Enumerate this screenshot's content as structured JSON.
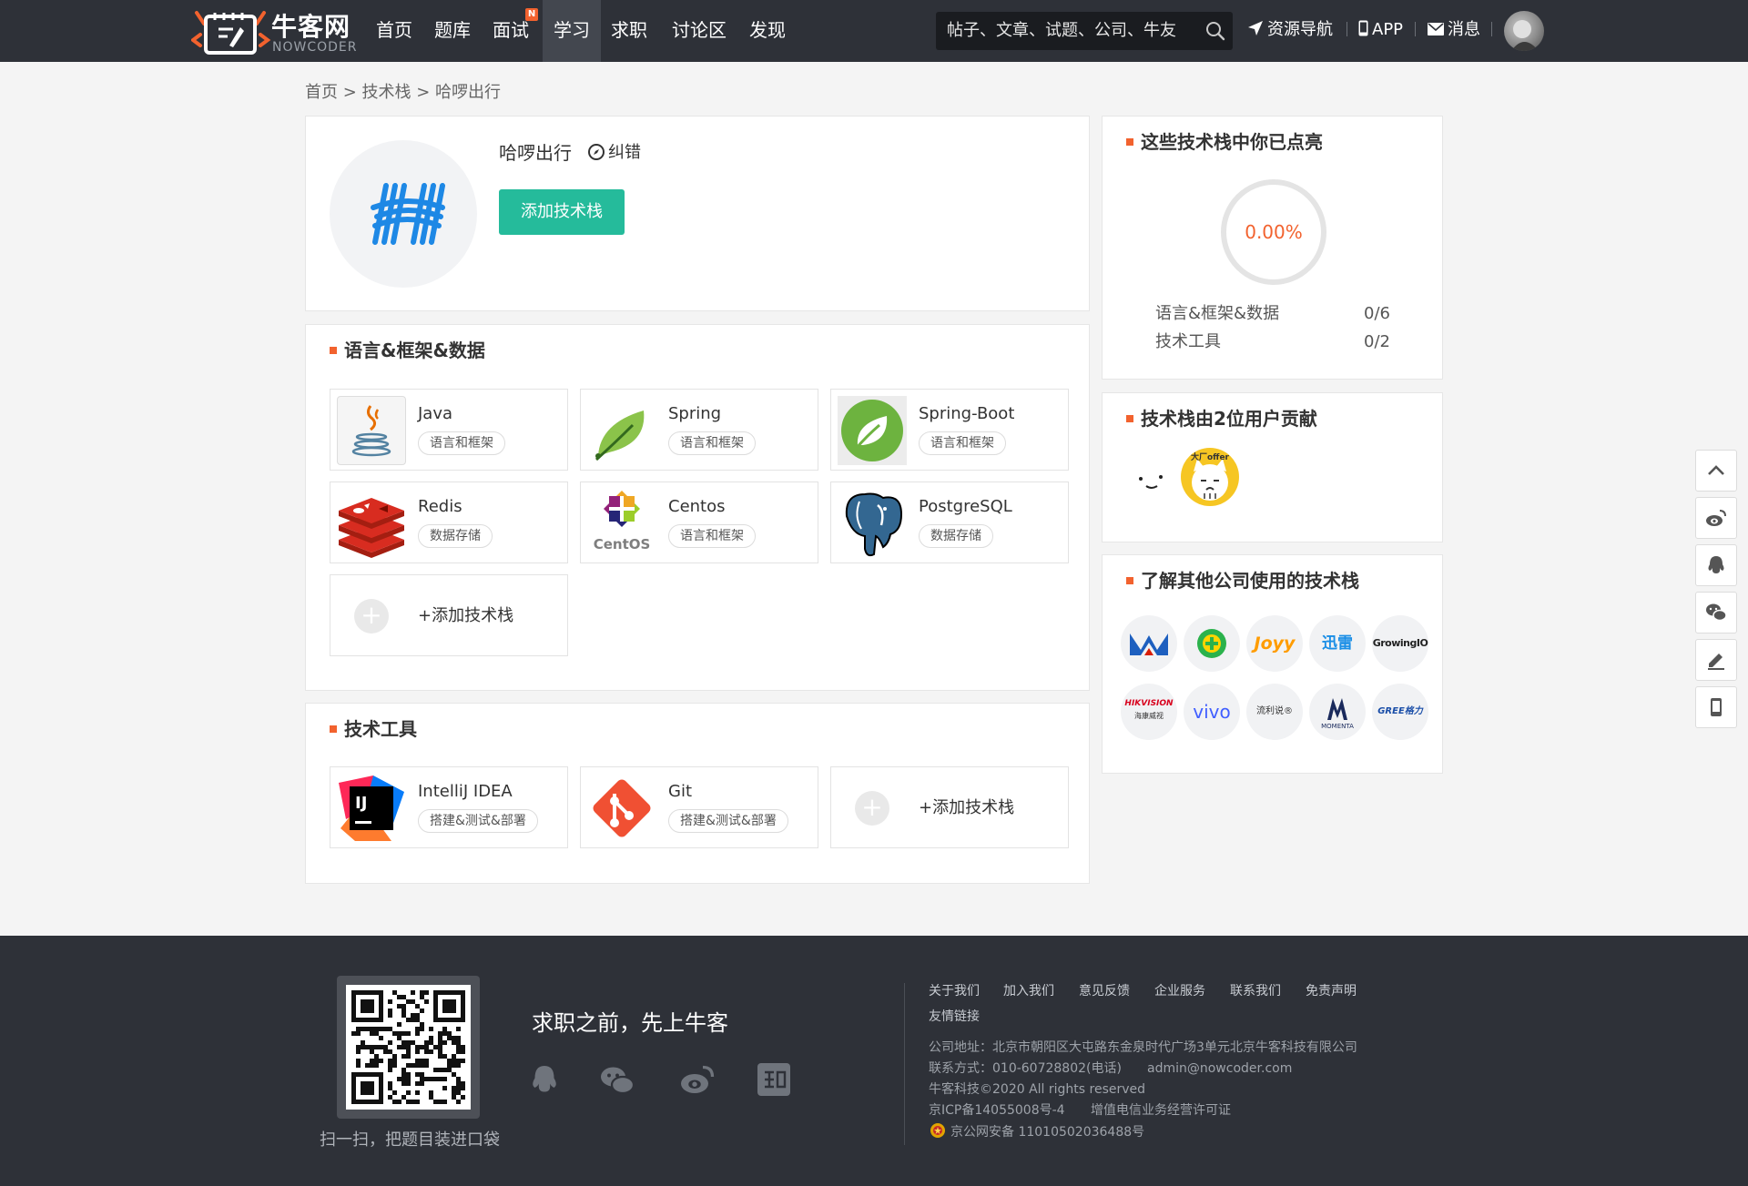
{
  "header": {
    "logo_cn": "牛客网",
    "logo_en": "NOWCODER",
    "nav": [
      "首页",
      "题库",
      "面试",
      "学习",
      "求职",
      "讨论区",
      "发现"
    ],
    "nav_active": "学习",
    "nav_badge": "N",
    "search_placeholder": "帖子、文章、试题、公司、牛友",
    "links": {
      "resources": "资源导航",
      "app": "APP",
      "messages": "消息"
    }
  },
  "breadcrumb": "首页 > 技术栈 > 哈啰出行",
  "company": {
    "name": "哈啰出行",
    "correct_label": "纠错",
    "add_button": "添加技术栈"
  },
  "sections": {
    "lang": {
      "title": "语言&框架&数据",
      "items": [
        {
          "name": "Java",
          "tag": "语言和框架",
          "icon": "java-icon"
        },
        {
          "name": "Spring",
          "tag": "语言和框架",
          "icon": "spring-icon"
        },
        {
          "name": "Spring-Boot",
          "tag": "语言和框架",
          "icon": "spring-boot-icon"
        },
        {
          "name": "Redis",
          "tag": "数据存储",
          "icon": "redis-icon"
        },
        {
          "name": "Centos",
          "tag": "语言和框架",
          "icon": "centos-icon"
        },
        {
          "name": "PostgreSQL",
          "tag": "数据存储",
          "icon": "postgresql-icon"
        }
      ],
      "add_label": "+添加技术栈"
    },
    "tools": {
      "title": "技术工具",
      "items": [
        {
          "name": "IntelliJ IDEA",
          "tag": "搭建&测试&部署",
          "icon": "intellij-icon"
        },
        {
          "name": "Git",
          "tag": "搭建&测试&部署",
          "icon": "git-icon"
        }
      ],
      "add_label": "+添加技术栈"
    }
  },
  "sidebar": {
    "lit": {
      "title": "这些技术栈中你已点亮",
      "percent": "0.00%",
      "progress": 0,
      "rows": [
        {
          "label": "语言&框架&数据",
          "value": "0/6"
        },
        {
          "label": "技术工具",
          "value": "0/2"
        }
      ]
    },
    "contributors": {
      "title": "技术栈由2位用户贡献",
      "avatar_text": "大厂offer"
    },
    "others": {
      "title": "了解其他公司使用的技术栈",
      "companies": [
        "Joyy",
        "迅雷",
        "GrowingIO",
        "HIKVISION",
        "海康威视",
        "vivo",
        "流利说®",
        "MOMENTA",
        "GREE格力"
      ]
    }
  },
  "footer": {
    "qr_caption": "扫一扫，把题目装进口袋",
    "slogan": "求职之前，先上牛客",
    "links": [
      "关于我们",
      "加入我们",
      "意见反馈",
      "企业服务",
      "联系我们",
      "免责声明",
      "友情链接"
    ],
    "address": "公司地址：北京市朝阳区大屯路东金泉时代广场3单元北京牛客科技有限公司",
    "contact": "联系方式：010-60728802(电话)",
    "email": "admin@nowcoder.com",
    "copyright": "牛客科技©2020 All rights reserved",
    "icp": "京ICP备14055008号-4",
    "license": "增值电信业务经营许可证",
    "police": "京公网安备 11010502036488号"
  },
  "colors": {
    "header_bg": "#2e3138",
    "accent": "#25bb9b",
    "orange": "#f2622e"
  }
}
